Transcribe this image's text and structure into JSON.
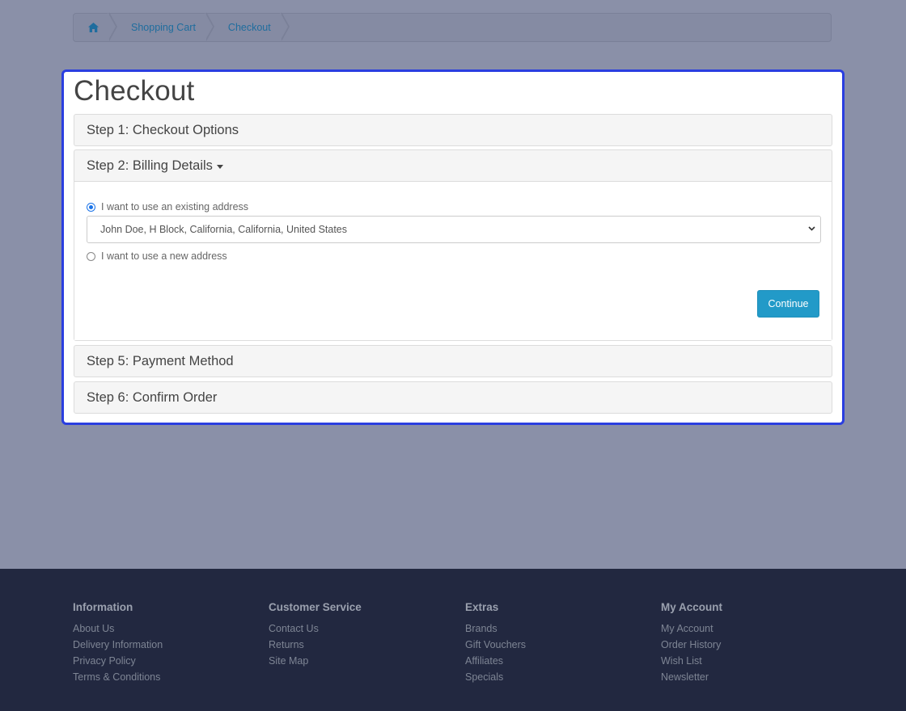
{
  "breadcrumb": {
    "items": [
      "Shopping Cart",
      "Checkout"
    ]
  },
  "page_title": "Checkout",
  "steps": {
    "step1": "Step 1: Checkout Options",
    "step2": "Step 2: Billing Details",
    "step5": "Step 5: Payment Method",
    "step6": "Step 6: Confirm Order"
  },
  "billing": {
    "existing_label": "I want to use an existing address",
    "existing_selected": true,
    "address_value": "John Doe, H Block, California, California, United States",
    "new_label": "I want to use a new address",
    "continue_label": "Continue"
  },
  "footer": {
    "columns": [
      {
        "title": "Information",
        "links": [
          "About Us",
          "Delivery Information",
          "Privacy Policy",
          "Terms & Conditions"
        ]
      },
      {
        "title": "Customer Service",
        "links": [
          "Contact Us",
          "Returns",
          "Site Map"
        ]
      },
      {
        "title": "Extras",
        "links": [
          "Brands",
          "Gift Vouchers",
          "Affiliates",
          "Specials"
        ]
      },
      {
        "title": "My Account",
        "links": [
          "My Account",
          "Order History",
          "Wish List",
          "Newsletter"
        ]
      }
    ]
  },
  "colors": {
    "accent_button": "#229ac8",
    "modal_border": "#2a3ee0",
    "link": "#1f6d9e",
    "footer_bg": "#222840"
  }
}
